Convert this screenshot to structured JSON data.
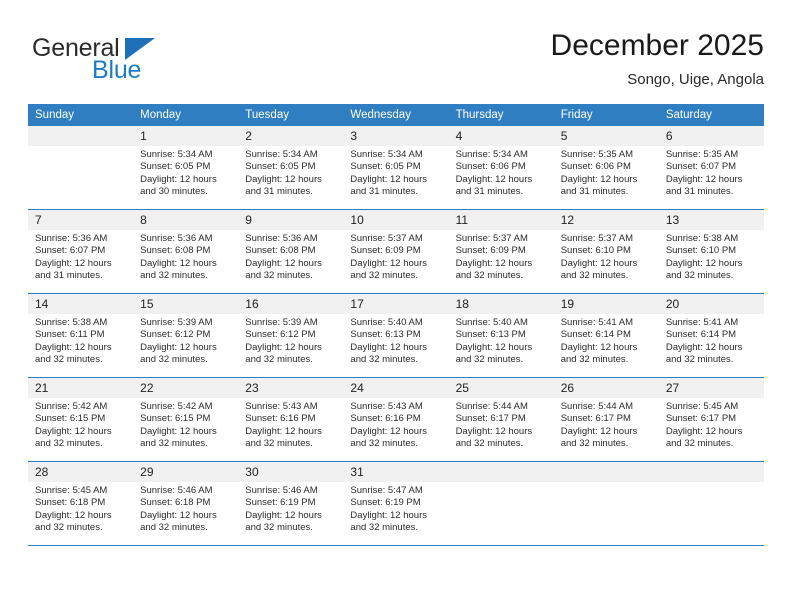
{
  "brand": {
    "name_top": "General",
    "name_bottom": "Blue",
    "triangle_icon": "brand-triangle-icon",
    "accent_color": "#1d7cc4"
  },
  "header": {
    "title": "December 2025",
    "subtitle": "Songo, Uige, Angola"
  },
  "theme": {
    "header_row_bg": "#2f7ec1",
    "daynum_bg": "#f0f0f0",
    "grid_line": "#2f7ec1"
  },
  "calendar": {
    "weekday_headers": [
      "Sunday",
      "Monday",
      "Tuesday",
      "Wednesday",
      "Thursday",
      "Friday",
      "Saturday"
    ],
    "weeks": [
      [
        {
          "day": "",
          "blank": true,
          "sunrise": "",
          "sunset": "",
          "daylight1": "",
          "daylight2": ""
        },
        {
          "day": "1",
          "sunrise": "Sunrise: 5:34 AM",
          "sunset": "Sunset: 6:05 PM",
          "daylight1": "Daylight: 12 hours",
          "daylight2": "and 30 minutes."
        },
        {
          "day": "2",
          "sunrise": "Sunrise: 5:34 AM",
          "sunset": "Sunset: 6:05 PM",
          "daylight1": "Daylight: 12 hours",
          "daylight2": "and 31 minutes."
        },
        {
          "day": "3",
          "sunrise": "Sunrise: 5:34 AM",
          "sunset": "Sunset: 6:05 PM",
          "daylight1": "Daylight: 12 hours",
          "daylight2": "and 31 minutes."
        },
        {
          "day": "4",
          "sunrise": "Sunrise: 5:34 AM",
          "sunset": "Sunset: 6:06 PM",
          "daylight1": "Daylight: 12 hours",
          "daylight2": "and 31 minutes."
        },
        {
          "day": "5",
          "sunrise": "Sunrise: 5:35 AM",
          "sunset": "Sunset: 6:06 PM",
          "daylight1": "Daylight: 12 hours",
          "daylight2": "and 31 minutes."
        },
        {
          "day": "6",
          "sunrise": "Sunrise: 5:35 AM",
          "sunset": "Sunset: 6:07 PM",
          "daylight1": "Daylight: 12 hours",
          "daylight2": "and 31 minutes."
        }
      ],
      [
        {
          "day": "7",
          "sunrise": "Sunrise: 5:36 AM",
          "sunset": "Sunset: 6:07 PM",
          "daylight1": "Daylight: 12 hours",
          "daylight2": "and 31 minutes."
        },
        {
          "day": "8",
          "sunrise": "Sunrise: 5:36 AM",
          "sunset": "Sunset: 6:08 PM",
          "daylight1": "Daylight: 12 hours",
          "daylight2": "and 32 minutes."
        },
        {
          "day": "9",
          "sunrise": "Sunrise: 5:36 AM",
          "sunset": "Sunset: 6:08 PM",
          "daylight1": "Daylight: 12 hours",
          "daylight2": "and 32 minutes."
        },
        {
          "day": "10",
          "sunrise": "Sunrise: 5:37 AM",
          "sunset": "Sunset: 6:09 PM",
          "daylight1": "Daylight: 12 hours",
          "daylight2": "and 32 minutes."
        },
        {
          "day": "11",
          "sunrise": "Sunrise: 5:37 AM",
          "sunset": "Sunset: 6:09 PM",
          "daylight1": "Daylight: 12 hours",
          "daylight2": "and 32 minutes."
        },
        {
          "day": "12",
          "sunrise": "Sunrise: 5:37 AM",
          "sunset": "Sunset: 6:10 PM",
          "daylight1": "Daylight: 12 hours",
          "daylight2": "and 32 minutes."
        },
        {
          "day": "13",
          "sunrise": "Sunrise: 5:38 AM",
          "sunset": "Sunset: 6:10 PM",
          "daylight1": "Daylight: 12 hours",
          "daylight2": "and 32 minutes."
        }
      ],
      [
        {
          "day": "14",
          "sunrise": "Sunrise: 5:38 AM",
          "sunset": "Sunset: 6:11 PM",
          "daylight1": "Daylight: 12 hours",
          "daylight2": "and 32 minutes."
        },
        {
          "day": "15",
          "sunrise": "Sunrise: 5:39 AM",
          "sunset": "Sunset: 6:12 PM",
          "daylight1": "Daylight: 12 hours",
          "daylight2": "and 32 minutes."
        },
        {
          "day": "16",
          "sunrise": "Sunrise: 5:39 AM",
          "sunset": "Sunset: 6:12 PM",
          "daylight1": "Daylight: 12 hours",
          "daylight2": "and 32 minutes."
        },
        {
          "day": "17",
          "sunrise": "Sunrise: 5:40 AM",
          "sunset": "Sunset: 6:13 PM",
          "daylight1": "Daylight: 12 hours",
          "daylight2": "and 32 minutes."
        },
        {
          "day": "18",
          "sunrise": "Sunrise: 5:40 AM",
          "sunset": "Sunset: 6:13 PM",
          "daylight1": "Daylight: 12 hours",
          "daylight2": "and 32 minutes."
        },
        {
          "day": "19",
          "sunrise": "Sunrise: 5:41 AM",
          "sunset": "Sunset: 6:14 PM",
          "daylight1": "Daylight: 12 hours",
          "daylight2": "and 32 minutes."
        },
        {
          "day": "20",
          "sunrise": "Sunrise: 5:41 AM",
          "sunset": "Sunset: 6:14 PM",
          "daylight1": "Daylight: 12 hours",
          "daylight2": "and 32 minutes."
        }
      ],
      [
        {
          "day": "21",
          "sunrise": "Sunrise: 5:42 AM",
          "sunset": "Sunset: 6:15 PM",
          "daylight1": "Daylight: 12 hours",
          "daylight2": "and 32 minutes."
        },
        {
          "day": "22",
          "sunrise": "Sunrise: 5:42 AM",
          "sunset": "Sunset: 6:15 PM",
          "daylight1": "Daylight: 12 hours",
          "daylight2": "and 32 minutes."
        },
        {
          "day": "23",
          "sunrise": "Sunrise: 5:43 AM",
          "sunset": "Sunset: 6:16 PM",
          "daylight1": "Daylight: 12 hours",
          "daylight2": "and 32 minutes."
        },
        {
          "day": "24",
          "sunrise": "Sunrise: 5:43 AM",
          "sunset": "Sunset: 6:16 PM",
          "daylight1": "Daylight: 12 hours",
          "daylight2": "and 32 minutes."
        },
        {
          "day": "25",
          "sunrise": "Sunrise: 5:44 AM",
          "sunset": "Sunset: 6:17 PM",
          "daylight1": "Daylight: 12 hours",
          "daylight2": "and 32 minutes."
        },
        {
          "day": "26",
          "sunrise": "Sunrise: 5:44 AM",
          "sunset": "Sunset: 6:17 PM",
          "daylight1": "Daylight: 12 hours",
          "daylight2": "and 32 minutes."
        },
        {
          "day": "27",
          "sunrise": "Sunrise: 5:45 AM",
          "sunset": "Sunset: 6:17 PM",
          "daylight1": "Daylight: 12 hours",
          "daylight2": "and 32 minutes."
        }
      ],
      [
        {
          "day": "28",
          "sunrise": "Sunrise: 5:45 AM",
          "sunset": "Sunset: 6:18 PM",
          "daylight1": "Daylight: 12 hours",
          "daylight2": "and 32 minutes."
        },
        {
          "day": "29",
          "sunrise": "Sunrise: 5:46 AM",
          "sunset": "Sunset: 6:18 PM",
          "daylight1": "Daylight: 12 hours",
          "daylight2": "and 32 minutes."
        },
        {
          "day": "30",
          "sunrise": "Sunrise: 5:46 AM",
          "sunset": "Sunset: 6:19 PM",
          "daylight1": "Daylight: 12 hours",
          "daylight2": "and 32 minutes."
        },
        {
          "day": "31",
          "sunrise": "Sunrise: 5:47 AM",
          "sunset": "Sunset: 6:19 PM",
          "daylight1": "Daylight: 12 hours",
          "daylight2": "and 32 minutes."
        },
        {
          "day": "",
          "blank": true,
          "sunrise": "",
          "sunset": "",
          "daylight1": "",
          "daylight2": ""
        },
        {
          "day": "",
          "blank": true,
          "sunrise": "",
          "sunset": "",
          "daylight1": "",
          "daylight2": ""
        },
        {
          "day": "",
          "blank": true,
          "sunrise": "",
          "sunset": "",
          "daylight1": "",
          "daylight2": ""
        }
      ]
    ]
  }
}
